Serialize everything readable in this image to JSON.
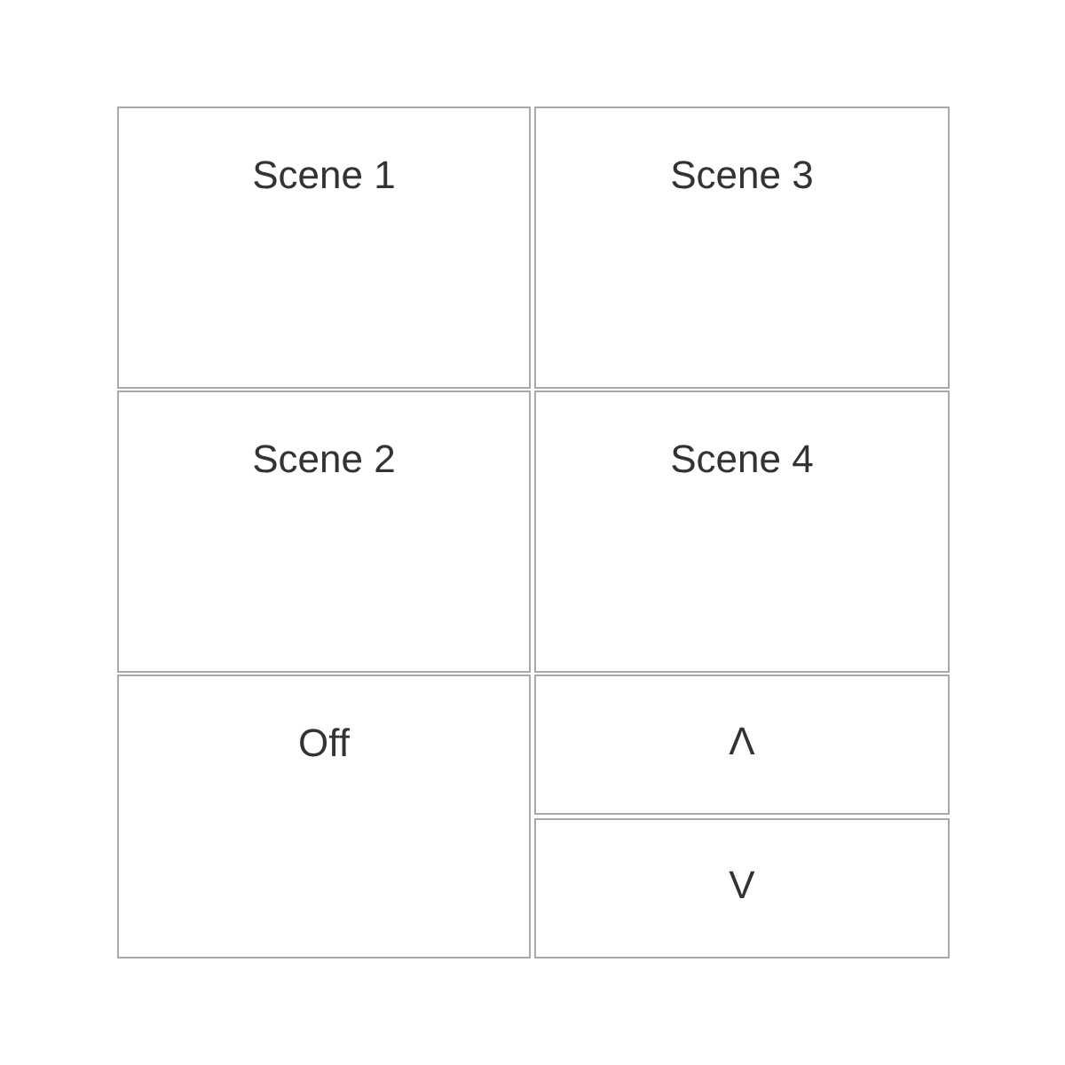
{
  "scenes": [
    {
      "label": "Scene 1"
    },
    {
      "label": "Scene 3"
    },
    {
      "label": "Scene 2"
    },
    {
      "label": "Scene 4"
    }
  ],
  "off_button": {
    "label": "Off"
  },
  "arrow_buttons": [
    {
      "label": "Λ"
    },
    {
      "label": "V"
    }
  ]
}
